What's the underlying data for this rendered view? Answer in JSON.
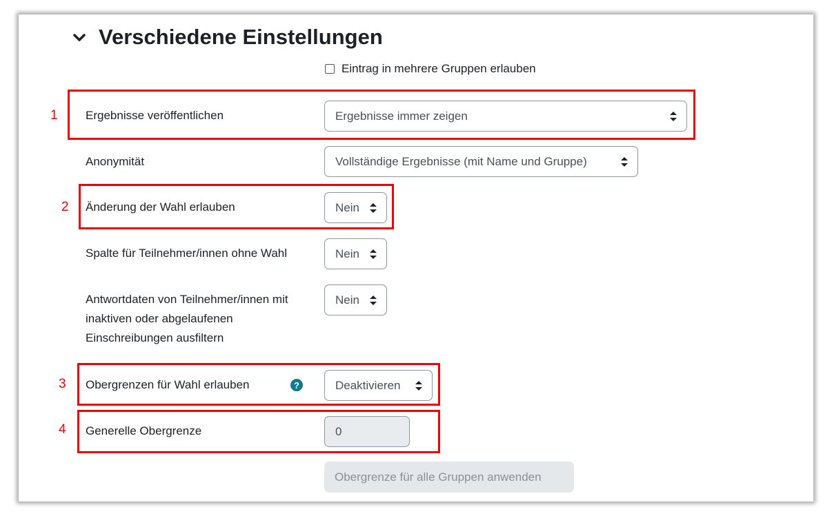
{
  "section": {
    "title": "Verschiedene Einstellungen"
  },
  "checkbox": {
    "label": "Eintrag in mehrere Gruppen erlauben",
    "checked": false
  },
  "fields": {
    "results": {
      "label": "Ergebnisse veröffentlichen",
      "value": "Ergebnisse immer zeigen"
    },
    "anonymity": {
      "label": "Anonymität",
      "value": "Vollständige Ergebnisse (mit Name und Gruppe)"
    },
    "change_choice": {
      "label": "Änderung der Wahl erlauben",
      "value": "Nein"
    },
    "no_choice_column": {
      "label": "Spalte für Teilnehmer/innen ohne Wahl",
      "value": "Nein"
    },
    "filter_inactive": {
      "label_line1": "Antwortdaten von Teilnehmer/innen mit",
      "label_line2": "inaktiven oder abgelaufenen",
      "label_line3": "Einschreibungen ausfiltern",
      "value": "Nein"
    },
    "limits": {
      "label": "Obergrenzen für Wahl erlauben",
      "value": "Deaktivieren",
      "help_glyph": "?"
    },
    "general_limit": {
      "label": "Generelle Obergrenze",
      "value": "0"
    }
  },
  "apply_button": {
    "label": "Obergrenze für alle Gruppen anwenden"
  },
  "annotations": [
    "1",
    "2",
    "3",
    "4"
  ],
  "colors": {
    "highlight": "#e8000b",
    "help_icon": "#117a8b"
  }
}
